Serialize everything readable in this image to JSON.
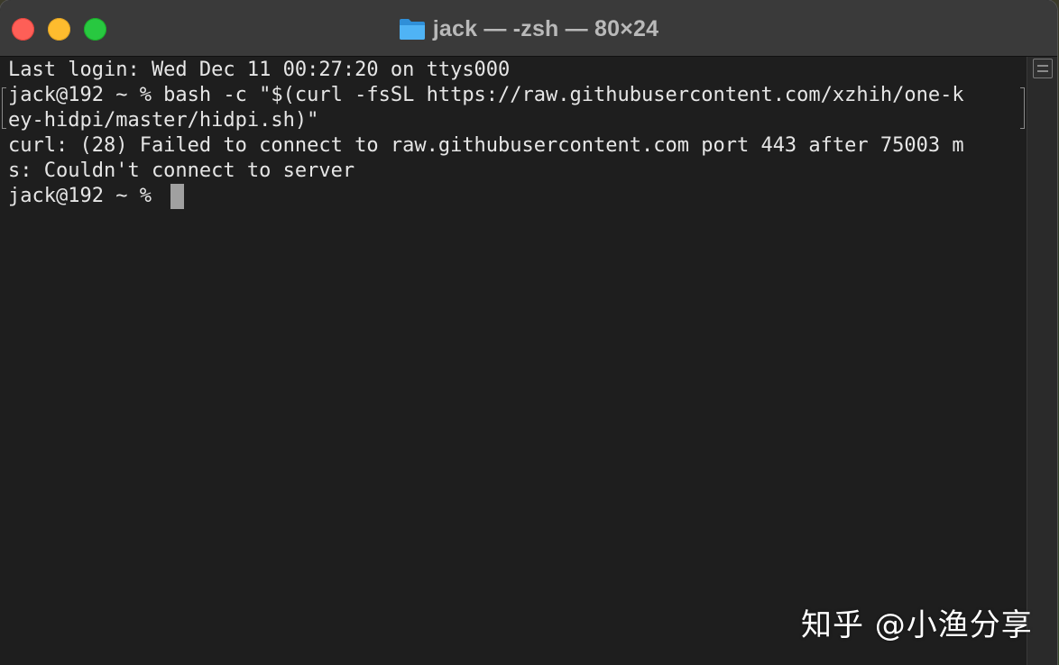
{
  "window": {
    "title": "jack — -zsh — 80×24"
  },
  "terminal": {
    "lines": [
      "Last login: Wed Dec 11 00:27:20 on ttys000",
      "jack@192 ~ % bash -c \"$(curl -fsSL https://raw.githubusercontent.com/xzhih/one-k",
      "ey-hidpi/master/hidpi.sh)\"",
      "curl: (28) Failed to connect to raw.githubusercontent.com port 443 after 75003 m",
      "s: Couldn't connect to server",
      "jack@192 ~ % "
    ]
  },
  "watermark": {
    "text": "知乎 @小渔分享"
  },
  "colors": {
    "close": "#fe5f57",
    "minimize": "#febc2e",
    "maximize": "#28c840",
    "terminal_bg": "#1e1e1e",
    "terminal_text": "#e6e6e6",
    "folder": "#3ba7f0"
  },
  "icons": {
    "title": "folder-icon",
    "scroll": "scroll-menu-icon"
  }
}
